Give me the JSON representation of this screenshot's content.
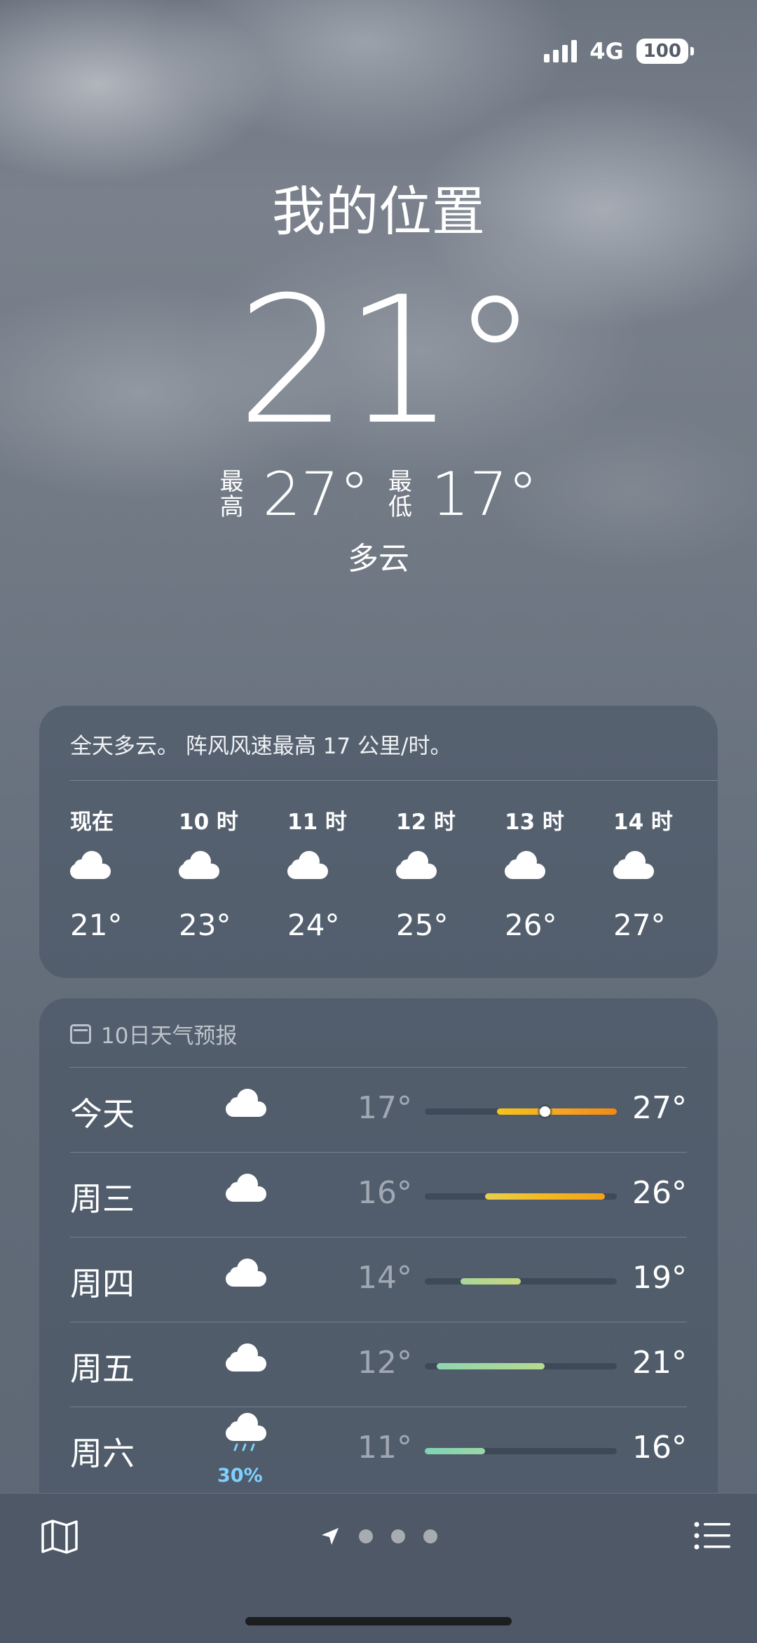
{
  "status": {
    "network": "4G",
    "battery": "100"
  },
  "current": {
    "location": "我的位置",
    "temperature": "21°",
    "high_label": "最高",
    "high": "27°",
    "low_label": "最低",
    "low": "17°",
    "condition": "多云"
  },
  "hourly": {
    "summary": "全天多云。 阵风风速最高 17 公里/时。",
    "items": [
      {
        "time": "现在",
        "icon": "cloud-icon",
        "temp": "21°"
      },
      {
        "time": "10 时",
        "icon": "cloud-icon",
        "temp": "23°"
      },
      {
        "time": "11 时",
        "icon": "cloud-icon",
        "temp": "24°"
      },
      {
        "time": "12 时",
        "icon": "cloud-icon",
        "temp": "25°"
      },
      {
        "time": "13 时",
        "icon": "cloud-icon",
        "temp": "26°"
      },
      {
        "time": "14 时",
        "icon": "cloud-icon",
        "temp": "27°"
      }
    ]
  },
  "daily": {
    "title": "10日天气预报",
    "range_min": 11,
    "range_max": 27,
    "current_temp": 21,
    "items": [
      {
        "day": "今天",
        "icon": "cloud-icon",
        "precip": "",
        "low": "17°",
        "high": "27°",
        "low_val": 17,
        "high_val": 27,
        "gradient": [
          "#f5c518",
          "#f5a623",
          "#f08a15"
        ],
        "current": true
      },
      {
        "day": "周三",
        "icon": "cloud-icon",
        "precip": "",
        "low": "16°",
        "high": "26°",
        "low_val": 16,
        "high_val": 26,
        "gradient": [
          "#e8cf50",
          "#f5b81e",
          "#f2a21a"
        ],
        "current": false
      },
      {
        "day": "周四",
        "icon": "cloud-icon",
        "precip": "",
        "low": "14°",
        "high": "19°",
        "low_val": 14,
        "high_val": 19,
        "gradient": [
          "#a9d59c",
          "#c8d77e"
        ],
        "current": false
      },
      {
        "day": "周五",
        "icon": "cloud-icon",
        "precip": "",
        "low": "12°",
        "high": "21°",
        "low_val": 12,
        "high_val": 21,
        "gradient": [
          "#8fd6b0",
          "#b7da8e"
        ],
        "current": false
      },
      {
        "day": "周六",
        "icon": "cloud-rain-icon",
        "precip": "30%",
        "low": "11°",
        "high": "16°",
        "low_val": 11,
        "high_val": 16,
        "gradient": [
          "#7fd3b4",
          "#9ad7a6"
        ],
        "current": false
      }
    ]
  },
  "tabbar": {
    "page_count": 3
  }
}
